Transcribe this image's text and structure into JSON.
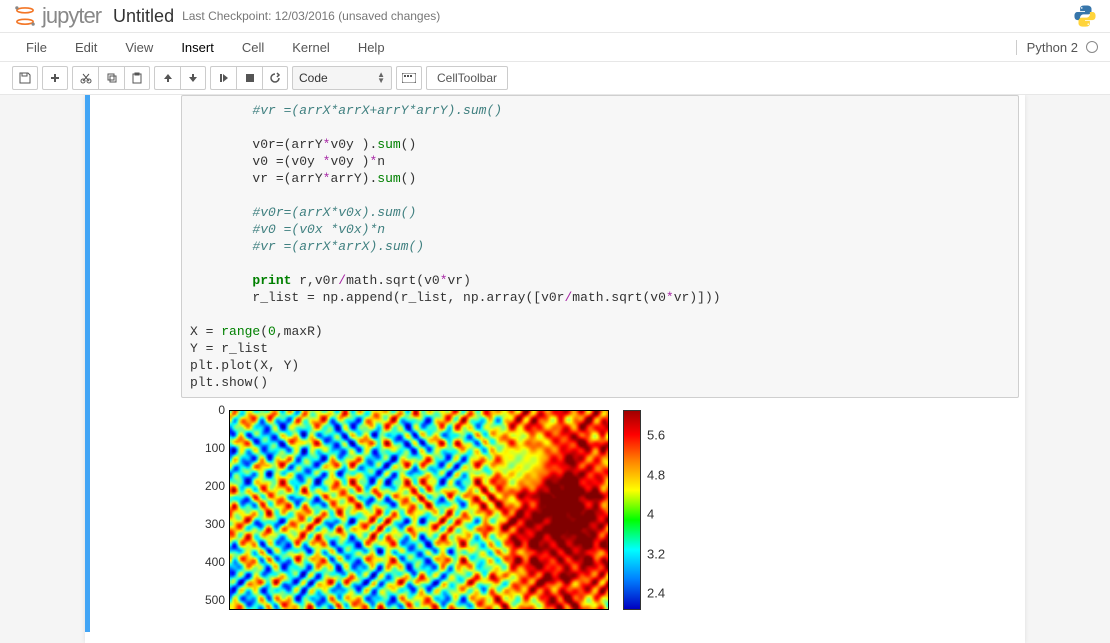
{
  "header": {
    "logo_text": "jupyter",
    "title": "Untitled",
    "checkpoint": "Last Checkpoint: 12/03/2016 (unsaved changes)"
  },
  "menubar": {
    "items": [
      "File",
      "Edit",
      "View",
      "Insert",
      "Cell",
      "Kernel",
      "Help"
    ],
    "active_index": 3,
    "kernel_name": "Python 2"
  },
  "toolbar": {
    "cell_type": "Code",
    "cell_toolbar_label": "CellToolbar"
  },
  "code": {
    "line1_c": "#vr =(arrX*arrX+arrY*arrY).sum()",
    "line2a": "v0r=(arrY",
    "line2b": "*",
    "line2c": "v0y ).",
    "line2d": "sum",
    "line2e": "()",
    "line3a": "v0 =(v0y ",
    "line3b": "*",
    "line3c": "v0y )",
    "line3d": "*",
    "line3e": "n",
    "line4a": "vr =(arrY",
    "line4b": "*",
    "line4c": "arrY).",
    "line4d": "sum",
    "line4e": "()",
    "line5_c": "#v0r=(arrX*v0x).sum()",
    "line6_c": "#v0 =(v0x *v0x)*n",
    "line7_c": "#vr =(arrX*arrX).sum()",
    "line8a": "print",
    "line8b": " r,v0r",
    "line8c": "/",
    "line8d": "math.sqrt(v0",
    "line8e": "*",
    "line8f": "vr)",
    "line9a": "r_list = np.append(r_list, np.array([v0r",
    "line9b": "/",
    "line9c": "math.sqrt(v0",
    "line9d": "*",
    "line9e": "vr)]))",
    "line10a": "X = ",
    "line10b": "range",
    "line10c": "(",
    "line10d": "0",
    "line10e": ",maxR)",
    "line11": "Y = r_list",
    "line12": "plt.plot(X, Y)",
    "line13": "plt.show()"
  },
  "chart_data": {
    "type": "heatmap",
    "title": "",
    "xlabel": "",
    "ylabel": "",
    "y_ticks": [
      0,
      100,
      200,
      300,
      400,
      500
    ],
    "ylim": [
      0,
      500
    ],
    "colorbar_ticks": [
      5.6,
      4.8,
      4.0,
      3.2,
      2.4
    ],
    "colorbar_range": [
      2.0,
      6.0
    ],
    "note": "Dense random heatmap (image data); exact per-pixel values not readable from screenshot."
  }
}
